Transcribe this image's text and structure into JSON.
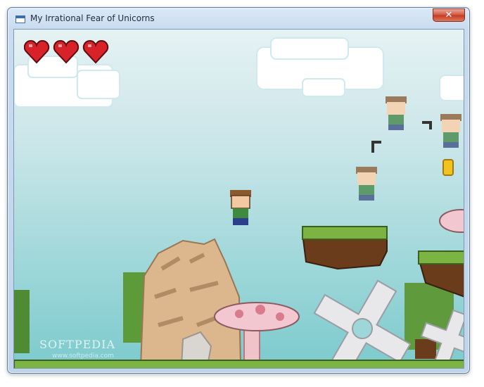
{
  "window": {
    "title": "My Irrational Fear of Unicorns",
    "icon": "app-window-icon",
    "close_glyph": "✕"
  },
  "game": {
    "lives": 3,
    "watermark": "SOFTPEDIA",
    "watermark_url": "www.softpedia.com"
  },
  "colors": {
    "sky_top": "#e6f2f4",
    "sky_bottom": "#7ccacd",
    "heart": "#d8222a",
    "grass": "#6aa63a",
    "dirt": "#6b3c1c",
    "rock": "#d9b48c",
    "mushroom_cap": "#f2c7cf"
  }
}
